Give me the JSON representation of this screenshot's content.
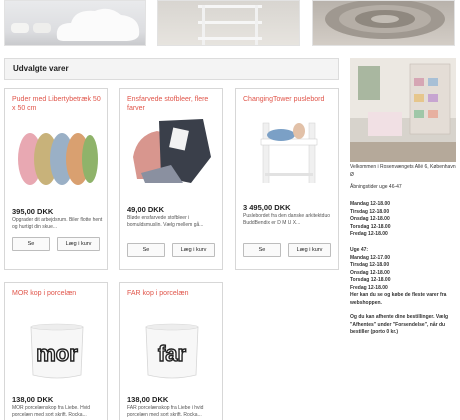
{
  "section": {
    "title": "Udvalgte varer"
  },
  "products": [
    {
      "title": "Puder med Libertybetræk 50 x 50 cm",
      "price": "395,00 DKK",
      "desc": "Opgrader dit arbejdsrum. Biler flotte hent og hurtigt din skue...",
      "see_label": "Se",
      "cart_label": "Læg i kurv"
    },
    {
      "title": "Ensfarvede stofbleer, flere farver",
      "price": "49,00 DKK",
      "desc": "Bløde ensfarvede stofbleer i bomuldsmuslin. Vælg mellem gå...",
      "see_label": "Se",
      "cart_label": "Læg i kurv"
    },
    {
      "title": "ChangingTower puslebord",
      "price": "3 495,00 DKK",
      "desc": "Puslebordet fra den danske arkitektduo BuddBendix er D M U X...",
      "see_label": "Se",
      "cart_label": "Læg i kurv"
    },
    {
      "title": "MOR kop i porcelæn",
      "price": "138,00 DKK",
      "desc": "MOR porcelænskop fra Liebe. Hvid porcelæn med sort skrift. Rocka...",
      "mug_text": "mor"
    },
    {
      "title": "FAR kop i porcelæn",
      "price": "138,00 DKK",
      "desc": "FAR porcelænskop fra Liebe i hvid porcelæn med sort skrift. Rocka...",
      "mug_text": "far"
    }
  ],
  "sidebar": {
    "welcome": "Velkommen i Rosenvængets Allé 6, København Ø",
    "hours_heading": "Åbningstider uge 46-47",
    "week46": [
      "Mandag 12-18.00",
      "Tirsdag 12-18.00",
      "Onsdag 12-18.00",
      "Torsdag 12-18.00",
      "Fredag 12-18.00"
    ],
    "week47_heading": "Uge 47:",
    "week47": [
      "Mandag 12-17.00",
      "Tirsdag 12-18.00",
      "Onsdag 12-18.00",
      "Torsdag 12-18.00",
      "Fredag 12-18.00"
    ],
    "note1": "Her kan du se og købe de fleste varer fra webshoppen.",
    "note2": "Og du kan afhente dine bestillinger. Vælg \"Afhentes\" under \"Forsendelse\", når du bestiller (porto 0 kr.)"
  },
  "colors": {
    "accent": "#e0554a",
    "border": "#d7d7d7"
  }
}
